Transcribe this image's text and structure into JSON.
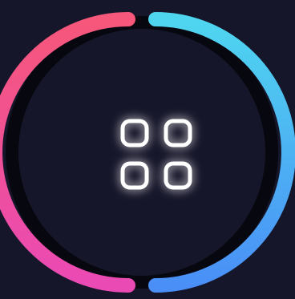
{
  "widget": {
    "icon": "app-grid-icon",
    "colors": {
      "background": "#16162a",
      "track": "#07070f",
      "left_arc_top": "#f6577a",
      "left_arc_bottom": "#ea4ab4",
      "right_arc_top": "#4fd6ef",
      "right_arc_bottom": "#4a8ff7",
      "icon_stroke": "#ffffff",
      "icon_glow": "#6c7cff"
    }
  }
}
